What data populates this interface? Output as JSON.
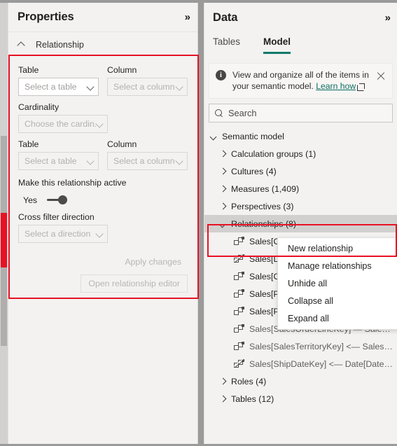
{
  "properties_panel": {
    "title": "Properties",
    "collapse_icon": "chevron-double-right-icon",
    "section": {
      "label": "Relationship",
      "caret": "chevron-up-icon"
    },
    "fields": {
      "table1_label": "Table",
      "table1_value": "Select a table",
      "column1_label": "Column",
      "column1_value": "Select a column",
      "cardinality_label": "Cardinality",
      "cardinality_value": "Choose the cardin...",
      "table2_label": "Table",
      "table2_value": "Select a table",
      "column2_label": "Column",
      "column2_value": "Select a column",
      "active_label": "Make this relationship active",
      "active_toggle_value": "Yes",
      "cross_filter_label": "Cross filter direction",
      "cross_filter_value": "Select a direction"
    },
    "buttons": {
      "apply": "Apply changes",
      "open_editor": "Open relationship editor"
    }
  },
  "data_panel": {
    "title": "Data",
    "collapse_icon": "chevron-double-right-icon",
    "tabs": [
      {
        "label": "Tables",
        "active": false
      },
      {
        "label": "Model",
        "active": true
      }
    ],
    "info_bar": {
      "icon": "info-icon",
      "text_line1": "View and organize all of the items in",
      "text_line2": "your semantic model. ",
      "link_text": "Learn how",
      "external_icon": "external-link-icon",
      "close_icon": "close-icon"
    },
    "search": {
      "icon": "search-icon",
      "placeholder": "Search"
    },
    "tree": {
      "root": {
        "label": "Semantic model",
        "expanded": true
      },
      "groups": [
        {
          "label": "Calculation groups (1)",
          "expanded": false
        },
        {
          "label": "Cultures (4)",
          "expanded": false
        },
        {
          "label": "Measures (1,409)",
          "expanded": false
        },
        {
          "label": "Perspectives (3)",
          "expanded": false
        }
      ],
      "relationships_node": {
        "label": "Relationships (8)",
        "expanded": true,
        "selected": true
      },
      "relationships": [
        {
          "label": "Sales[C",
          "icon": "relationship-icon",
          "inactive": false
        },
        {
          "label": "Sales[D",
          "icon": "relationship-inactive-icon",
          "inactive": true
        },
        {
          "label": "Sales[C",
          "icon": "relationship-icon",
          "inactive": false
        },
        {
          "label": "Sales[P",
          "icon": "relationship-icon",
          "inactive": false
        },
        {
          "label": "Sales[P",
          "icon": "relationship-icon",
          "inactive": false
        },
        {
          "label": "Sales[SalesOrderLineKey] — Sales Or...",
          "icon": "relationship-icon",
          "inactive": false
        },
        {
          "label": "Sales[SalesTerritoryKey] <— Sales Te...",
          "icon": "relationship-icon",
          "inactive": false
        },
        {
          "label": "Sales[ShipDateKey] <— Date[DateKey]",
          "icon": "relationship-inactive-icon",
          "inactive": true
        }
      ],
      "footer_groups": [
        {
          "label": "Roles (4)",
          "expanded": false
        },
        {
          "label": "Tables (12)",
          "expanded": false
        }
      ]
    }
  },
  "context_menu": {
    "items": [
      {
        "label": "New relationship",
        "highlighted": true
      },
      {
        "label": "Manage relationships",
        "highlighted": false
      },
      {
        "label": "Unhide all",
        "highlighted": false
      },
      {
        "label": "Collapse all",
        "highlighted": false
      },
      {
        "label": "Expand all",
        "highlighted": false
      }
    ]
  },
  "annotations": {
    "highlight_color": "#e81123",
    "accent_color": "#10796b"
  }
}
